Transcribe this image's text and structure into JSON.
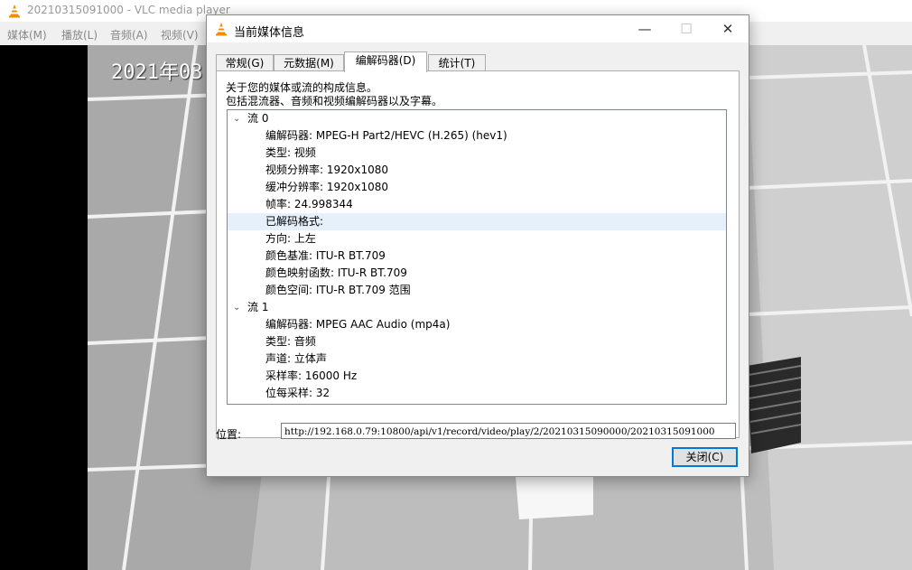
{
  "main_window": {
    "title": "20210315091000 - VLC media player",
    "menu": [
      "媒体(M)",
      "播放(L)",
      "音频(A)",
      "视频(V)"
    ],
    "overlay_timestamp": "2021年03"
  },
  "dialog": {
    "title": "当前媒体信息",
    "title_buttons": {
      "minimize": "—",
      "maximize": "☐",
      "close": "✕"
    },
    "tabs": [
      "常规(G)",
      "元数据(M)",
      "编解码器(D)",
      "统计(T)"
    ],
    "active_tab": "编解码器(D)",
    "description": [
      "关于您的媒体或流的构成信息。",
      "包括混流器、音频和视频编解码器以及字幕。"
    ],
    "streams": [
      {
        "label": "流 0",
        "items": [
          "编解码器: MPEG-H Part2/HEVC (H.265) (hev1)",
          "类型: 视频",
          "视频分辨率: 1920x1080",
          "缓冲分辨率: 1920x1080",
          "帧率: 24.998344",
          "已解码格式:",
          "方向: 上左",
          "颜色基准: ITU-R BT.709",
          "颜色映射函数: ITU-R BT.709",
          "颜色空间: ITU-R BT.709 范围"
        ]
      },
      {
        "label": "流 1",
        "items": [
          "编解码器: MPEG AAC Audio (mp4a)",
          "类型: 音频",
          "声道: 立体声",
          "采样率: 16000 Hz",
          "位每采样: 32"
        ]
      }
    ],
    "selected_item": "已解码格式:",
    "location_label": "位置:",
    "location_value": "http://192.168.0.79:10800/api/v1/record/video/play/2/20210315090000/20210315091000",
    "close_button": "关闭(C)"
  },
  "colors": {
    "selection": "#e5f0fb",
    "focus_border": "#0078d7",
    "vlc_orange": "#f08c00"
  },
  "icons": {
    "app": "vlc-cone-icon",
    "expand": "chevron-down-icon"
  }
}
